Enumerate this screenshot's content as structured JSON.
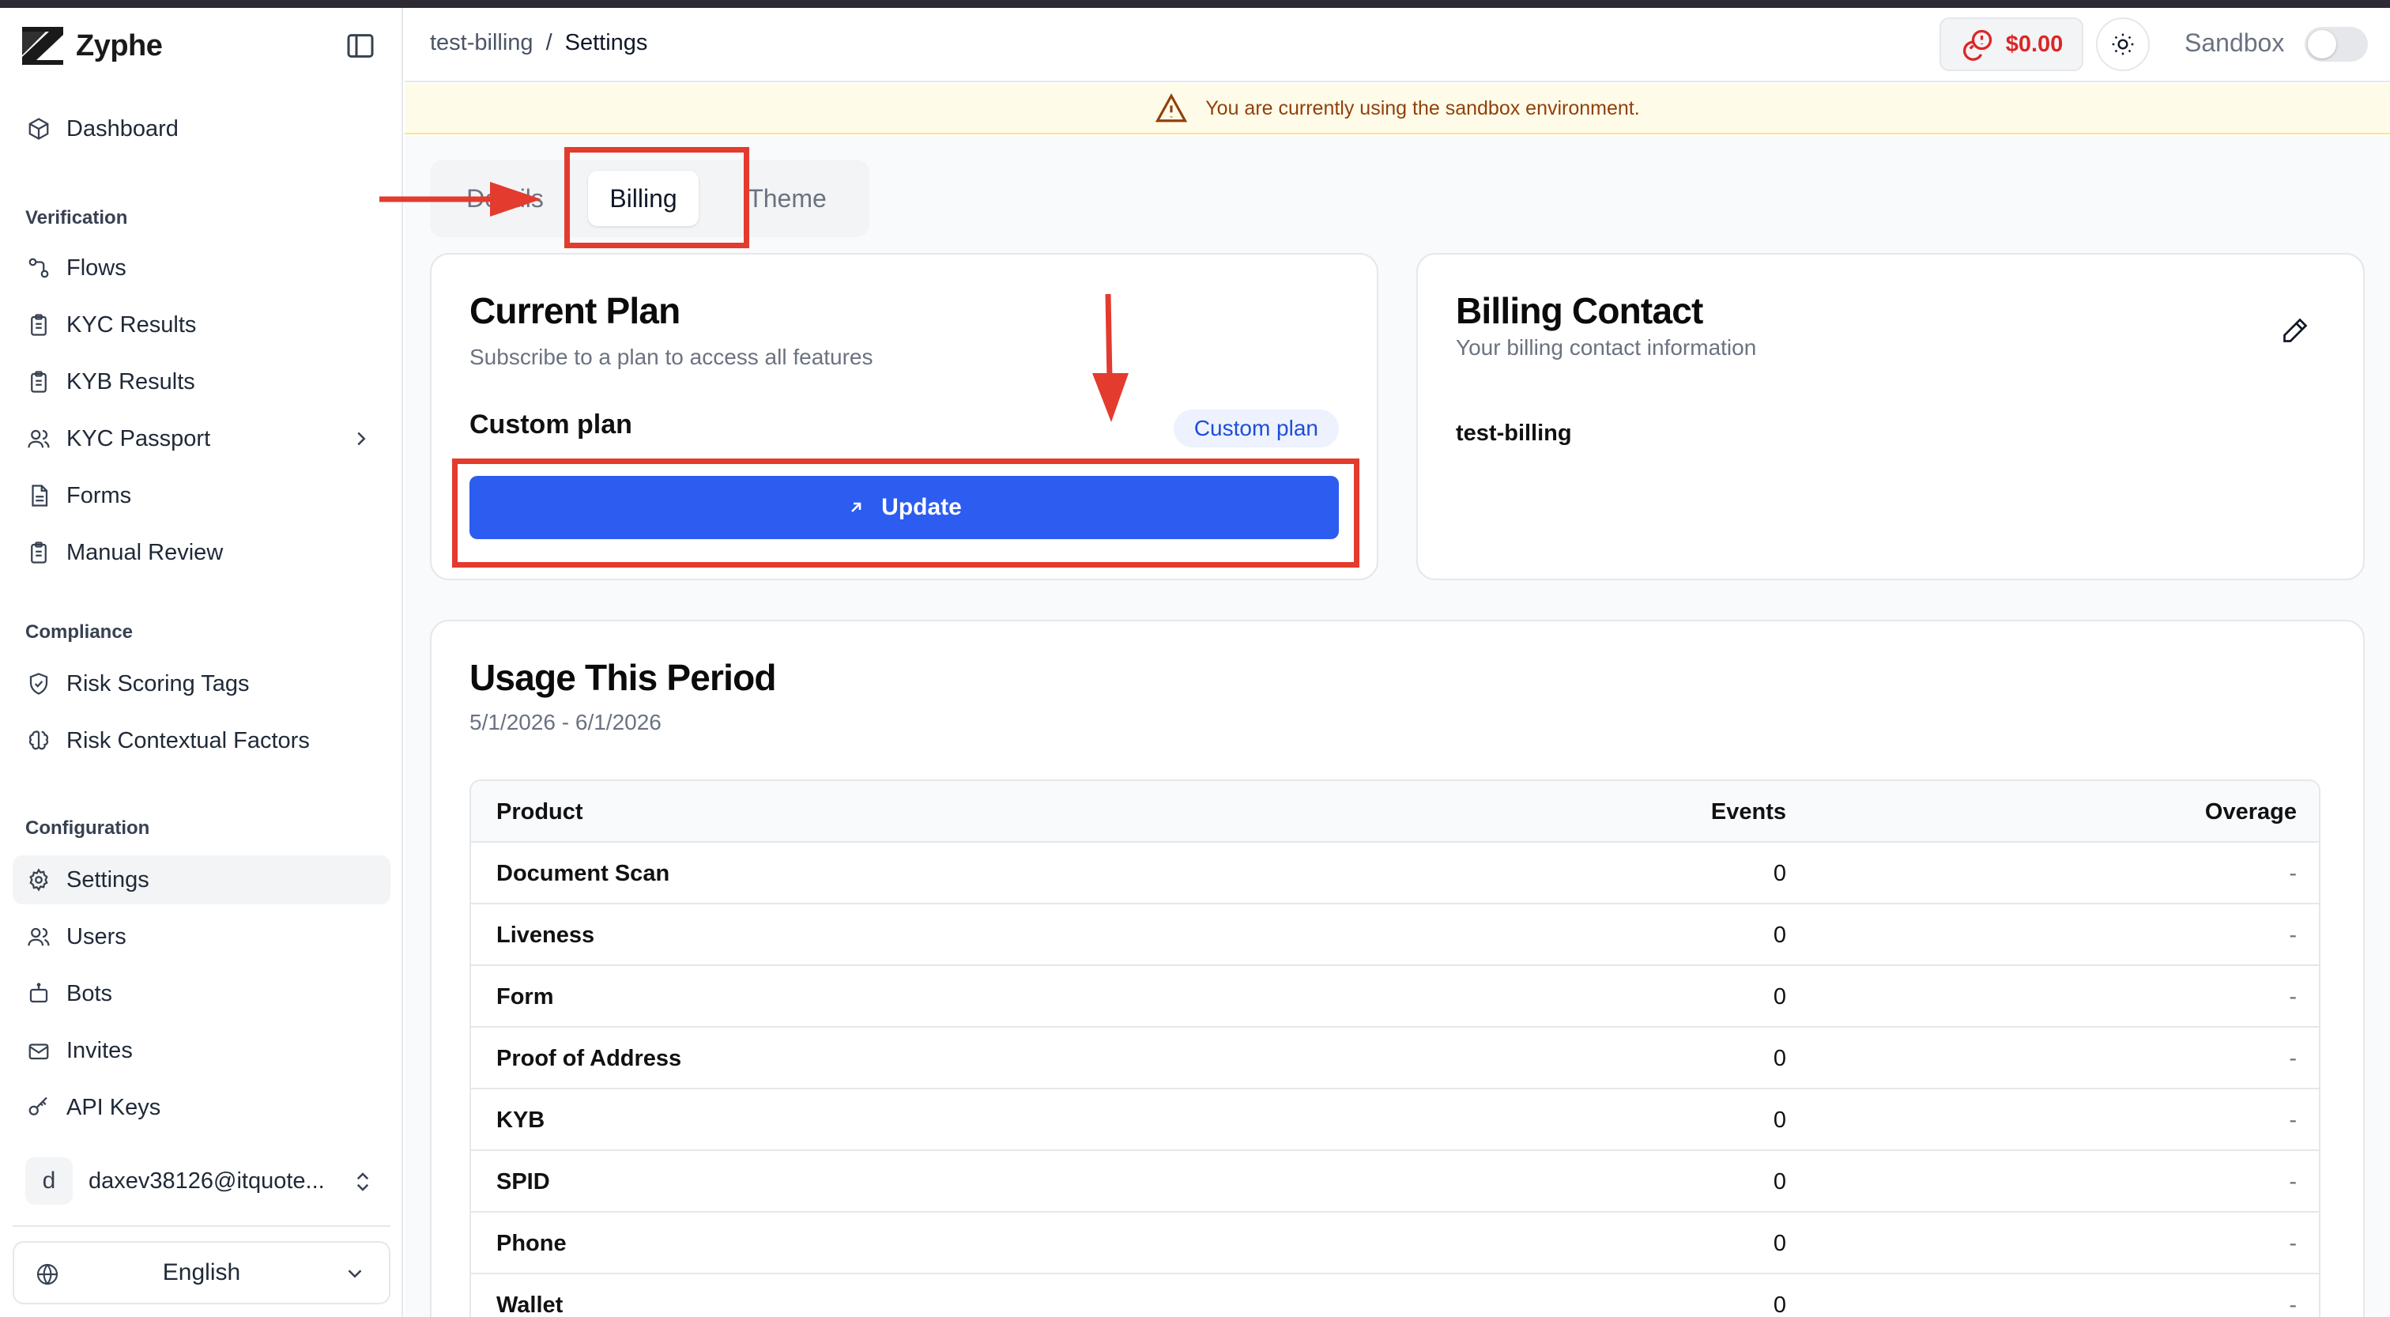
{
  "app": {
    "name": "Zyphe"
  },
  "header": {
    "breadcrumb_parent": "test-billing",
    "breadcrumb_sep": "/",
    "breadcrumb_current": "Settings",
    "balance": "$0.00",
    "sandbox_label": "Sandbox"
  },
  "banner": {
    "text": "You are currently using the sandbox environment."
  },
  "sidebar": {
    "dashboard": "Dashboard",
    "verification_label": "Verification",
    "flows": "Flows",
    "kyc_results": "KYC Results",
    "kyb_results": "KYB Results",
    "kyc_passport": "KYC Passport",
    "forms": "Forms",
    "manual_review": "Manual Review",
    "compliance_label": "Compliance",
    "risk_scoring_tags": "Risk Scoring Tags",
    "risk_contextual_factors": "Risk Contextual Factors",
    "configuration_label": "Configuration",
    "settings": "Settings",
    "users": "Users",
    "bots": "Bots",
    "invites": "Invites",
    "api_keys": "API Keys",
    "user_initial": "d",
    "user_email": "daxev38126@itquote...",
    "language": "English"
  },
  "tabs": {
    "details": "Details",
    "billing": "Billing",
    "theme": "Theme"
  },
  "current_plan": {
    "title": "Current Plan",
    "subtitle": "Subscribe to a plan to access all features",
    "plan_name": "Custom plan",
    "badge": "Custom plan",
    "update_label": "Update"
  },
  "billing_contact": {
    "title": "Billing Contact",
    "subtitle": "Your billing contact information",
    "name": "test-billing"
  },
  "usage": {
    "title": "Usage This Period",
    "period": "5/1/2026 - 6/1/2026",
    "columns": {
      "product": "Product",
      "events": "Events",
      "overage": "Overage"
    },
    "rows": [
      {
        "product": "Document Scan",
        "events": "0",
        "overage": "-"
      },
      {
        "product": "Liveness",
        "events": "0",
        "overage": "-"
      },
      {
        "product": "Form",
        "events": "0",
        "overage": "-"
      },
      {
        "product": "Proof of Address",
        "events": "0",
        "overage": "-"
      },
      {
        "product": "KYB",
        "events": "0",
        "overage": "-"
      },
      {
        "product": "SPID",
        "events": "0",
        "overage": "-"
      },
      {
        "product": "Phone",
        "events": "0",
        "overage": "-"
      },
      {
        "product": "Wallet",
        "events": "0",
        "overage": "-"
      }
    ]
  },
  "colors": {
    "primary": "#2c5cf0",
    "annotation": "#e33b2e",
    "danger": "#dc2626"
  }
}
